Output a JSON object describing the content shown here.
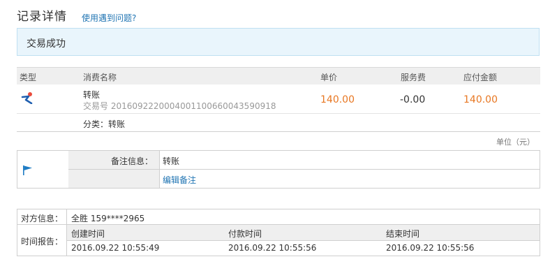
{
  "header": {
    "title": "记录详情",
    "help_link": "使用遇到问题?"
  },
  "status": {
    "text": "交易成功"
  },
  "table": {
    "columns": [
      "类型",
      "消费名称",
      "单价",
      "服务费",
      "应付金额"
    ],
    "row": {
      "type_icon": "transfer-icon",
      "name": "转账",
      "trade_no": "交易号 2016092220004001100660043590918",
      "price": "140.00",
      "fee": "-0.00",
      "payable": "140.00",
      "category": "分类：转账"
    }
  },
  "unit_label": "单位（元）",
  "note": {
    "flag_icon": "flag-icon",
    "label": "备注信息：",
    "value": "转账",
    "edit_link": "编辑备注"
  },
  "info": {
    "party_label": "对方信息：",
    "party_value": "全胜 159****2965",
    "time_label": "时间报告：",
    "time_headers": [
      "创建时间",
      "付款时间",
      "结束时间"
    ],
    "time_values": [
      "2016.09.22 10:55:49",
      "2016.09.22 10:55:56",
      "2016.09.22 10:55:56"
    ]
  },
  "colors": {
    "accent_link": "#2175b3",
    "amount": "#e87722",
    "success_bg": "#e9f5fc"
  }
}
